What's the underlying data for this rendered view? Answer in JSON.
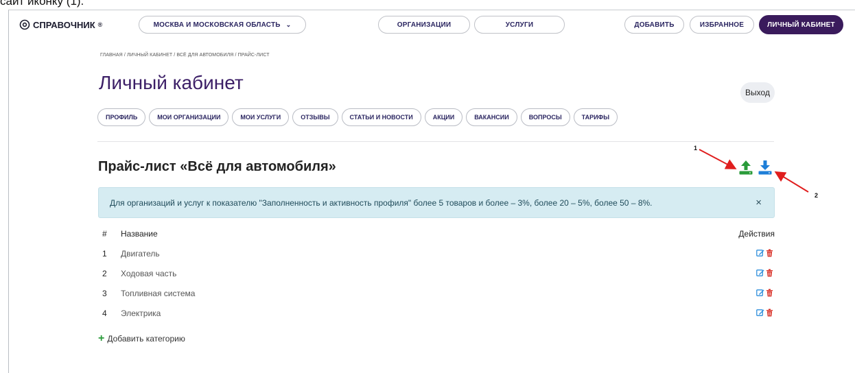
{
  "caption": "сайт иконку (1).",
  "header": {
    "logo": {
      "text": "СПРАВОЧНИК",
      "mark": "®"
    },
    "region": "МОСКВА И МОСКОВСКАЯ ОБЛАСТЬ",
    "nav": {
      "organizations": "ОРГАНИЗАЦИИ",
      "services": "УСЛУГИ"
    },
    "add": "ДОБАВИТЬ",
    "favorites": "ИЗБРАННОЕ",
    "cabinet": "ЛИЧНЫЙ КАБИНЕТ"
  },
  "breadcrumb": "ГЛАВНАЯ / ЛИЧНЫЙ КАБИНЕТ / ВСЁ ДЛЯ АВТОМОБИЛЯ / ПРАЙС-ЛИСТ",
  "page": {
    "title": "Личный кабинет",
    "logout": "Выход"
  },
  "tabs": [
    {
      "label": "ПРОФИЛЬ"
    },
    {
      "label": "МОИ ОРГАНИЗАЦИИ"
    },
    {
      "label": "МОИ УСЛУГИ"
    },
    {
      "label": "ОТЗЫВЫ"
    },
    {
      "label": "СТАТЬИ И НОВОСТИ"
    },
    {
      "label": "АКЦИИ"
    },
    {
      "label": "ВАКАНСИИ"
    },
    {
      "label": "ВОПРОСЫ"
    },
    {
      "label": "ТАРИФЫ"
    }
  ],
  "pricelist": {
    "title": "Прайс-лист «Всё для автомобиля»",
    "upload_icon": "upload-icon",
    "download_icon": "download-icon",
    "annotations": {
      "one": "1",
      "two": "2"
    }
  },
  "alert": {
    "text": "Для организаций и услуг к показателю \"Заполненность и активность профиля\" более 5 товаров и более – 3%, более 20 – 5%, более 50 – 8%.",
    "close": "×"
  },
  "table": {
    "headers": {
      "num": "#",
      "name": "Название",
      "actions": "Действия"
    },
    "rows": [
      {
        "num": "1",
        "name": "Двигатель"
      },
      {
        "num": "2",
        "name": "Ходовая часть"
      },
      {
        "num": "3",
        "name": "Топливная система"
      },
      {
        "num": "4",
        "name": "Электрика"
      }
    ]
  },
  "add_category": {
    "plus": "+",
    "label": "Добавить категорию"
  },
  "colors": {
    "brand": "#3a1b5c",
    "upload": "#2a9b3a",
    "download": "#1e7fd8",
    "edit": "#2f8fdc",
    "delete": "#d9342b",
    "arrow": "#e01e1e",
    "alert_bg": "#d6ecf2"
  }
}
